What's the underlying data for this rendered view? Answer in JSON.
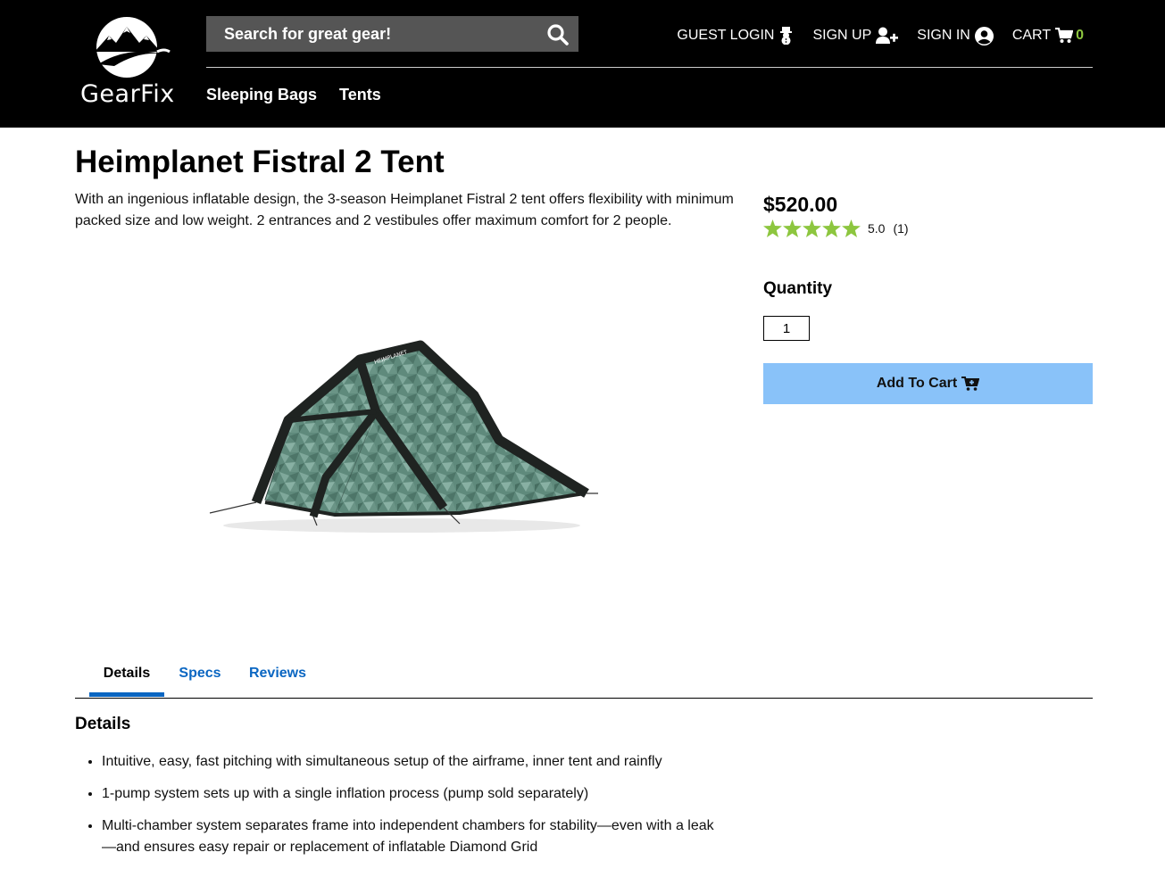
{
  "brand": {
    "name": "GearFix"
  },
  "search": {
    "placeholder": "Search for great gear!"
  },
  "topnav": {
    "guest_login": "GUEST LOGIN",
    "sign_up": "SIGN UP",
    "sign_in": "SIGN IN",
    "cart": "CART",
    "cart_count": "0"
  },
  "categories": [
    "Sleeping Bags",
    "Tents"
  ],
  "product": {
    "title": "Heimplanet Fistral 2 Tent",
    "description": "With an ingenious inflatable design, the 3-season Heimplanet Fistral 2 tent offers flexibility with minimum packed size and low weight. 2 entrances and 2 vestibules offer maximum comfort for 2 people.",
    "price": "$520.00",
    "rating": {
      "stars": 5,
      "score": "5.0",
      "count": "(1)"
    },
    "quantity_label": "Quantity",
    "quantity_value": "1",
    "add_to_cart": "Add To Cart"
  },
  "tabs": [
    "Details",
    "Specs",
    "Reviews"
  ],
  "details": {
    "heading": "Details",
    "items": [
      "Intuitive, easy, fast pitching with simultaneous setup of the airframe, inner tent and rainfly",
      "1-pump system sets up with a single inflation process (pump sold separately)",
      "Multi-chamber system separates frame into independent chambers for stability—even with a leak—and ensures easy repair or replacement of inflatable Diamond Grid"
    ]
  },
  "colors": {
    "header_bg": "#000000",
    "search_bg": "#555555",
    "cart_count": "#8dc63f",
    "star": "#8dc63f",
    "add_to_cart_bg": "#89c2f9",
    "tab_accent": "#0a66c2"
  },
  "icons": {
    "search": "search-icon",
    "guest": "snowman-icon",
    "sign_up": "user-plus-icon",
    "sign_in": "user-circle-icon",
    "cart": "cart-icon",
    "add_to_cart": "cart-plus-icon"
  }
}
